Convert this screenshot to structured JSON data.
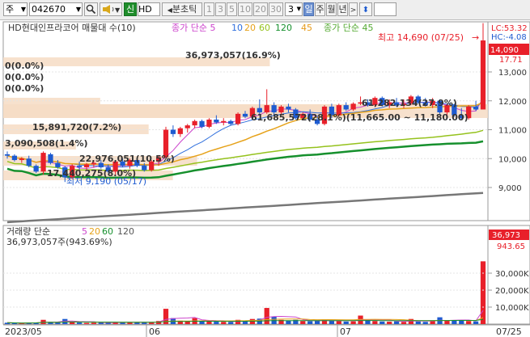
{
  "toolbar": {
    "market": "주",
    "code": "042670",
    "stock_name": "HD현",
    "buttons": {
      "short_sell": "신",
      "mode": "분초틱"
    },
    "periods": [
      "1",
      "3",
      "5",
      "10",
      "20",
      "30"
    ],
    "period_value": "3",
    "tabs": [
      "일",
      "주",
      "월",
      "년"
    ],
    "active_tab": "일"
  },
  "colors": {
    "up": "#e8202a",
    "down": "#1e5bd0",
    "volume_up": "#e8202a",
    "volume_down": "#1e5bd0"
  },
  "price_panel": {
    "title": "HD현대인프라코어 매물대 수(10)",
    "legend": [
      {
        "label": "종가 단순 5",
        "color": "#cc44cc"
      },
      {
        "label": "10",
        "color": "#2f6fdd"
      },
      {
        "label": "20",
        "color": "#e6a21a"
      },
      {
        "label": "60",
        "color": "#95c21d"
      },
      {
        "label": "120",
        "color": "#16902d"
      },
      {
        "label": "45",
        "color": "#e69a1a"
      },
      {
        "label": "종가 단순 45",
        "color": "#55aa33"
      }
    ],
    "lc_label": "LC:53.32",
    "hc_label": "HC:-4.08",
    "price_tag": "14,090",
    "price_tag_2": "17.71",
    "y_ticks": [
      "13,000",
      "12,000",
      "11,000",
      "10,000",
      "9,000"
    ],
    "high_annotation": "최고 14,690 (07/25)",
    "low_annotation": "최저 9,190 (05/17)",
    "volume_profile_labels": [
      "36,973,057(16.9%)",
      "0(0.0%)",
      "0(0.0%)",
      "0(0.0%)",
      "15,891,720(7.2%)",
      "3,090,508(1.4%)",
      "22,976,051(10.5%)",
      "17,440,275(8.0%)",
      "61,685,572(28.1%)(11,665.00 ~ 11,180.00)",
      "61,282,134(27.9%)"
    ]
  },
  "volume_panel": {
    "title": "거래량 단순",
    "legend": [
      {
        "label": "5",
        "color": "#cc44cc"
      },
      {
        "label": "20",
        "color": "#e6a21a"
      },
      {
        "label": "60",
        "color": "#16902d"
      },
      {
        "label": "120",
        "color": "#555555"
      }
    ],
    "value_text": "36,973,057주(943.69%)",
    "tag_value": "36,973",
    "tag_pct": "943.65",
    "y_ticks": [
      "30,000K",
      "20,000K",
      "10,000K"
    ]
  },
  "x_axis": [
    "2023/05",
    "06",
    "07",
    "07/25"
  ],
  "chart_data": {
    "type": "candlestick",
    "y_ticks": [
      13000,
      12000,
      11000,
      10000,
      9000
    ],
    "high": {
      "value": 14690,
      "date": "07/25"
    },
    "low": {
      "value": 9190,
      "date": "05/17"
    },
    "volume_profile": [
      {
        "volume": 36973057,
        "pct": 16.9
      },
      {
        "volume": 0,
        "pct": 0.0
      },
      {
        "volume": 0,
        "pct": 0.0
      },
      {
        "volume": 0,
        "pct": 0.0
      },
      {
        "volume": 15891720,
        "pct": 7.2
      },
      {
        "volume": 3090508,
        "pct": 1.4
      },
      {
        "volume": 22976051,
        "pct": 10.5
      },
      {
        "volume": 17440275,
        "pct": 8.0
      },
      {
        "volume": 61685572,
        "pct": 28.1,
        "range": "11,665.00 ~ 11,180.00"
      },
      {
        "volume": 61282134,
        "pct": 27.9
      }
    ],
    "candles": [
      [
        10150,
        10250,
        10000,
        10100
      ],
      [
        10100,
        10150,
        9900,
        9950
      ],
      [
        9950,
        10050,
        9850,
        10000
      ],
      [
        10000,
        10100,
        9700,
        9750
      ],
      [
        9750,
        9800,
        9500,
        9550
      ],
      [
        9550,
        10250,
        9450,
        10200
      ],
      [
        10150,
        10200,
        9800,
        9850
      ],
      [
        9850,
        9950,
        9650,
        9700
      ],
      [
        9700,
        9750,
        9190,
        9350
      ],
      [
        9350,
        9800,
        9300,
        9750
      ],
      [
        9750,
        9900,
        9600,
        9700
      ],
      [
        9700,
        9850,
        9600,
        9800
      ],
      [
        9800,
        9950,
        9700,
        9850
      ],
      [
        9850,
        9950,
        9650,
        9700
      ],
      [
        9700,
        9800,
        9500,
        9550
      ],
      [
        9550,
        9950,
        9450,
        9900
      ],
      [
        9900,
        10000,
        9700,
        9750
      ],
      [
        9750,
        10000,
        9650,
        9950
      ],
      [
        9950,
        10050,
        9700,
        9750
      ],
      [
        9750,
        9850,
        9550,
        9600
      ],
      [
        9600,
        9950,
        9550,
        9900
      ],
      [
        9900,
        10100,
        9750,
        10050
      ],
      [
        10050,
        11100,
        10000,
        11000
      ],
      [
        11000,
        11150,
        10750,
        10850
      ],
      [
        10850,
        11100,
        10750,
        11050
      ],
      [
        11050,
        11200,
        10900,
        11150
      ],
      [
        11150,
        11350,
        11050,
        11300
      ],
      [
        11300,
        11350,
        11050,
        11100
      ],
      [
        11100,
        11400,
        11050,
        11350
      ],
      [
        11350,
        11500,
        11200,
        11250
      ],
      [
        11250,
        11400,
        11150,
        11300
      ],
      [
        11300,
        11350,
        11150,
        11200
      ],
      [
        11200,
        11600,
        11150,
        11550
      ],
      [
        11550,
        11650,
        11400,
        11450
      ],
      [
        11450,
        11800,
        11400,
        11750
      ],
      [
        11750,
        12050,
        11500,
        11600
      ],
      [
        11600,
        12400,
        11550,
        11850
      ],
      [
        11850,
        11950,
        11500,
        11600
      ],
      [
        11600,
        11850,
        11500,
        11800
      ],
      [
        11800,
        11900,
        11600,
        11700
      ],
      [
        11700,
        11750,
        11350,
        11400
      ],
      [
        11400,
        11600,
        11350,
        11550
      ],
      [
        11550,
        11700,
        11300,
        11350
      ],
      [
        11350,
        11500,
        11150,
        11200
      ],
      [
        11200,
        11850,
        11150,
        11800
      ],
      [
        11800,
        11900,
        11400,
        11500
      ],
      [
        11500,
        11900,
        11450,
        11850
      ],
      [
        11850,
        11950,
        11650,
        11700
      ],
      [
        11700,
        11950,
        11650,
        11900
      ],
      [
        11900,
        12150,
        11850,
        11950
      ],
      [
        11950,
        12050,
        11800,
        11850
      ],
      [
        11850,
        12150,
        11800,
        12100
      ],
      [
        12100,
        12150,
        11800,
        11850
      ],
      [
        11850,
        12050,
        11750,
        11950
      ],
      [
        11950,
        12100,
        11800,
        11850
      ],
      [
        11850,
        12050,
        11750,
        11900
      ],
      [
        11900,
        12200,
        11850,
        12150
      ],
      [
        12150,
        12200,
        11900,
        11950
      ],
      [
        11950,
        12100,
        11800,
        11850
      ],
      [
        11850,
        12100,
        11750,
        12000
      ],
      [
        12000,
        12050,
        11550,
        11600
      ],
      [
        11600,
        11900,
        11500,
        11850
      ],
      [
        11850,
        11900,
        11450,
        11500
      ],
      [
        11500,
        11750,
        11350,
        11400
      ],
      [
        11400,
        11850,
        11350,
        11800
      ],
      [
        11800,
        12000,
        11650,
        11700
      ],
      [
        11700,
        14690,
        11700,
        14090
      ]
    ],
    "volume": [
      800,
      600,
      500,
      700,
      900,
      2500,
      1200,
      900,
      3000,
      1400,
      900,
      700,
      800,
      900,
      1000,
      1200,
      900,
      1100,
      1200,
      900,
      1000,
      1800,
      9000,
      3500,
      2000,
      1600,
      3500,
      2000,
      1500,
      1400,
      1300,
      1200,
      2500,
      1800,
      3000,
      3200,
      9500,
      4500,
      2500,
      2000,
      2500,
      1800,
      1700,
      2000,
      2800,
      2000,
      1800,
      1500,
      1600,
      5000,
      2500,
      1800,
      1500,
      1400,
      1600,
      1300,
      3000,
      1500,
      1300,
      1700,
      4000,
      2000,
      2200,
      2000,
      1800,
      1600,
      36973
    ]
  }
}
